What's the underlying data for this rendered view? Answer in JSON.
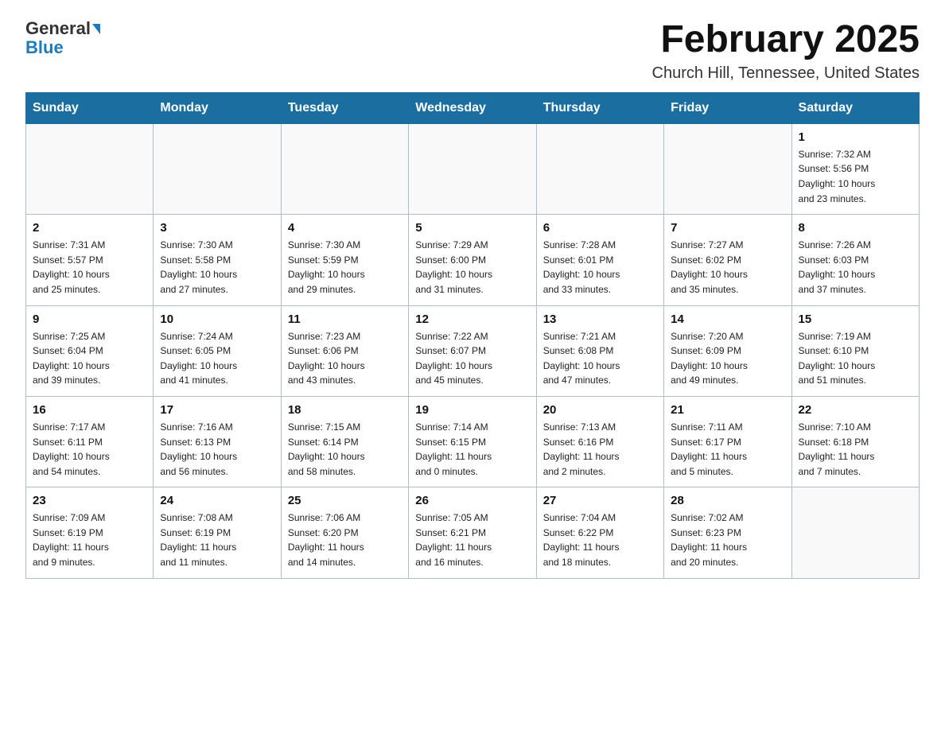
{
  "logo": {
    "general": "General",
    "blue": "Blue"
  },
  "header": {
    "title": "February 2025",
    "subtitle": "Church Hill, Tennessee, United States"
  },
  "weekdays": [
    "Sunday",
    "Monday",
    "Tuesday",
    "Wednesday",
    "Thursday",
    "Friday",
    "Saturday"
  ],
  "weeks": [
    [
      {
        "day": "",
        "info": ""
      },
      {
        "day": "",
        "info": ""
      },
      {
        "day": "",
        "info": ""
      },
      {
        "day": "",
        "info": ""
      },
      {
        "day": "",
        "info": ""
      },
      {
        "day": "",
        "info": ""
      },
      {
        "day": "1",
        "info": "Sunrise: 7:32 AM\nSunset: 5:56 PM\nDaylight: 10 hours\nand 23 minutes."
      }
    ],
    [
      {
        "day": "2",
        "info": "Sunrise: 7:31 AM\nSunset: 5:57 PM\nDaylight: 10 hours\nand 25 minutes."
      },
      {
        "day": "3",
        "info": "Sunrise: 7:30 AM\nSunset: 5:58 PM\nDaylight: 10 hours\nand 27 minutes."
      },
      {
        "day": "4",
        "info": "Sunrise: 7:30 AM\nSunset: 5:59 PM\nDaylight: 10 hours\nand 29 minutes."
      },
      {
        "day": "5",
        "info": "Sunrise: 7:29 AM\nSunset: 6:00 PM\nDaylight: 10 hours\nand 31 minutes."
      },
      {
        "day": "6",
        "info": "Sunrise: 7:28 AM\nSunset: 6:01 PM\nDaylight: 10 hours\nand 33 minutes."
      },
      {
        "day": "7",
        "info": "Sunrise: 7:27 AM\nSunset: 6:02 PM\nDaylight: 10 hours\nand 35 minutes."
      },
      {
        "day": "8",
        "info": "Sunrise: 7:26 AM\nSunset: 6:03 PM\nDaylight: 10 hours\nand 37 minutes."
      }
    ],
    [
      {
        "day": "9",
        "info": "Sunrise: 7:25 AM\nSunset: 6:04 PM\nDaylight: 10 hours\nand 39 minutes."
      },
      {
        "day": "10",
        "info": "Sunrise: 7:24 AM\nSunset: 6:05 PM\nDaylight: 10 hours\nand 41 minutes."
      },
      {
        "day": "11",
        "info": "Sunrise: 7:23 AM\nSunset: 6:06 PM\nDaylight: 10 hours\nand 43 minutes."
      },
      {
        "day": "12",
        "info": "Sunrise: 7:22 AM\nSunset: 6:07 PM\nDaylight: 10 hours\nand 45 minutes."
      },
      {
        "day": "13",
        "info": "Sunrise: 7:21 AM\nSunset: 6:08 PM\nDaylight: 10 hours\nand 47 minutes."
      },
      {
        "day": "14",
        "info": "Sunrise: 7:20 AM\nSunset: 6:09 PM\nDaylight: 10 hours\nand 49 minutes."
      },
      {
        "day": "15",
        "info": "Sunrise: 7:19 AM\nSunset: 6:10 PM\nDaylight: 10 hours\nand 51 minutes."
      }
    ],
    [
      {
        "day": "16",
        "info": "Sunrise: 7:17 AM\nSunset: 6:11 PM\nDaylight: 10 hours\nand 54 minutes."
      },
      {
        "day": "17",
        "info": "Sunrise: 7:16 AM\nSunset: 6:13 PM\nDaylight: 10 hours\nand 56 minutes."
      },
      {
        "day": "18",
        "info": "Sunrise: 7:15 AM\nSunset: 6:14 PM\nDaylight: 10 hours\nand 58 minutes."
      },
      {
        "day": "19",
        "info": "Sunrise: 7:14 AM\nSunset: 6:15 PM\nDaylight: 11 hours\nand 0 minutes."
      },
      {
        "day": "20",
        "info": "Sunrise: 7:13 AM\nSunset: 6:16 PM\nDaylight: 11 hours\nand 2 minutes."
      },
      {
        "day": "21",
        "info": "Sunrise: 7:11 AM\nSunset: 6:17 PM\nDaylight: 11 hours\nand 5 minutes."
      },
      {
        "day": "22",
        "info": "Sunrise: 7:10 AM\nSunset: 6:18 PM\nDaylight: 11 hours\nand 7 minutes."
      }
    ],
    [
      {
        "day": "23",
        "info": "Sunrise: 7:09 AM\nSunset: 6:19 PM\nDaylight: 11 hours\nand 9 minutes."
      },
      {
        "day": "24",
        "info": "Sunrise: 7:08 AM\nSunset: 6:19 PM\nDaylight: 11 hours\nand 11 minutes."
      },
      {
        "day": "25",
        "info": "Sunrise: 7:06 AM\nSunset: 6:20 PM\nDaylight: 11 hours\nand 14 minutes."
      },
      {
        "day": "26",
        "info": "Sunrise: 7:05 AM\nSunset: 6:21 PM\nDaylight: 11 hours\nand 16 minutes."
      },
      {
        "day": "27",
        "info": "Sunrise: 7:04 AM\nSunset: 6:22 PM\nDaylight: 11 hours\nand 18 minutes."
      },
      {
        "day": "28",
        "info": "Sunrise: 7:02 AM\nSunset: 6:23 PM\nDaylight: 11 hours\nand 20 minutes."
      },
      {
        "day": "",
        "info": ""
      }
    ]
  ]
}
